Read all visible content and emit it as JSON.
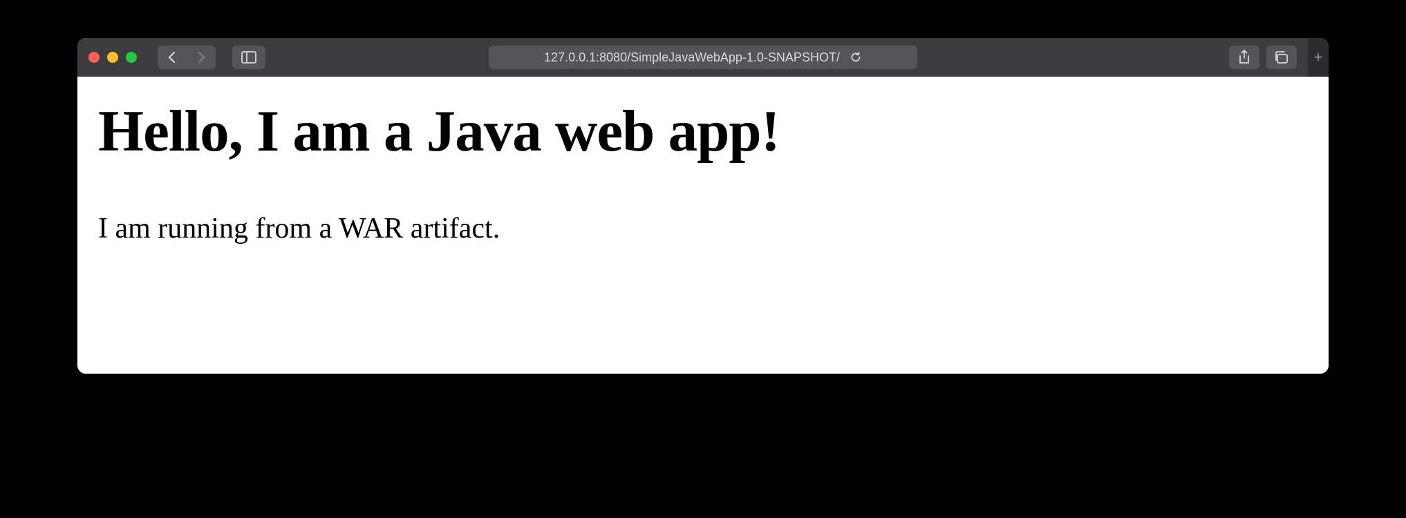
{
  "browser": {
    "url": "127.0.0.1:8080/SimpleJavaWebApp-1.0-SNAPSHOT/"
  },
  "page": {
    "heading": "Hello, I am a Java web app!",
    "paragraph": "I am running from a WAR artifact."
  }
}
